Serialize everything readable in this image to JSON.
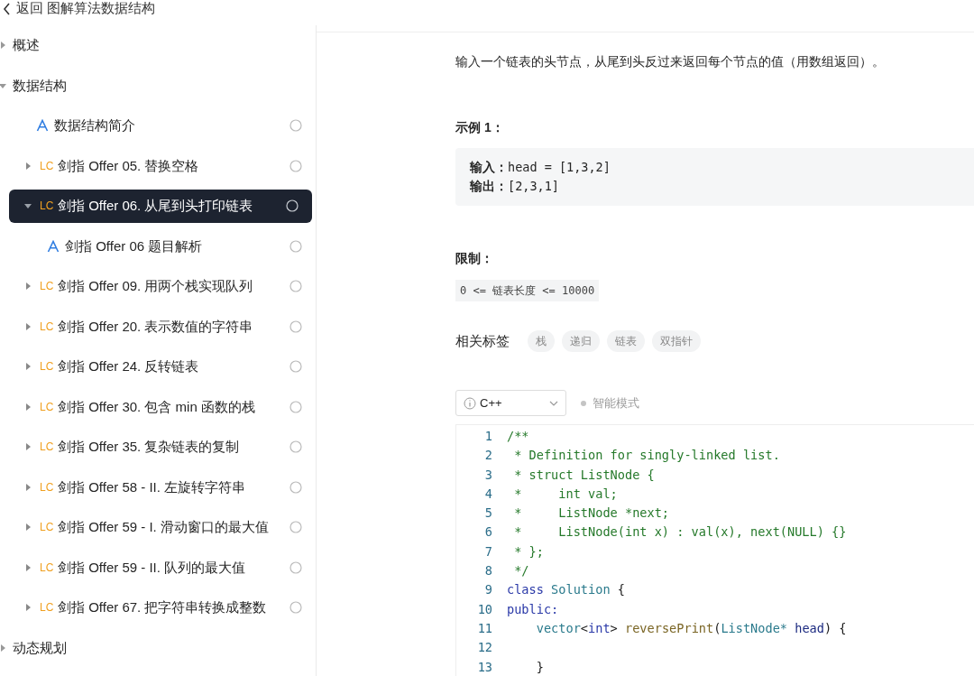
{
  "header": {
    "back_label": "返回 图解算法数据结构"
  },
  "sidebar": {
    "items": [
      {
        "label": "概述",
        "expanded": false
      },
      {
        "label": "数据结构",
        "expanded": true,
        "children": [
          {
            "kind": "article",
            "label": "数据结构简介",
            "selected": false,
            "done": false
          },
          {
            "kind": "leetcode",
            "badge": "LC",
            "label": "剑指 Offer 05. 替换空格",
            "expanded": false,
            "selected": false,
            "done": false
          },
          {
            "kind": "leetcode",
            "badge": "LC",
            "label": "剑指 Offer 06. 从尾到头打印链表",
            "expanded": true,
            "selected": true,
            "done": false,
            "children": [
              {
                "kind": "article",
                "label": "剑指 Offer 06 题目解析",
                "selected": false,
                "done": false
              }
            ]
          },
          {
            "kind": "leetcode",
            "badge": "LC",
            "label": "剑指 Offer 09. 用两个栈实现队列",
            "expanded": false,
            "selected": false,
            "done": false
          },
          {
            "kind": "leetcode",
            "badge": "LC",
            "label": "剑指 Offer 20. 表示数值的字符串",
            "expanded": false,
            "selected": false,
            "done": false
          },
          {
            "kind": "leetcode",
            "badge": "LC",
            "label": "剑指 Offer 24. 反转链表",
            "expanded": false,
            "selected": false,
            "done": false
          },
          {
            "kind": "leetcode",
            "badge": "LC",
            "label": "剑指 Offer 30. 包含 min 函数的栈",
            "expanded": false,
            "selected": false,
            "done": false
          },
          {
            "kind": "leetcode",
            "badge": "LC",
            "label": "剑指 Offer 35. 复杂链表的复制",
            "expanded": false,
            "selected": false,
            "done": false
          },
          {
            "kind": "leetcode",
            "badge": "LC",
            "label": "剑指 Offer 58 - II. 左旋转字符串",
            "expanded": false,
            "selected": false,
            "done": false
          },
          {
            "kind": "leetcode",
            "badge": "LC",
            "label": "剑指 Offer 59 - I. 滑动窗口的最大值",
            "expanded": false,
            "selected": false,
            "done": false
          },
          {
            "kind": "leetcode",
            "badge": "LC",
            "label": "剑指 Offer 59 - II. 队列的最大值",
            "expanded": false,
            "selected": false,
            "done": false
          },
          {
            "kind": "leetcode",
            "badge": "LC",
            "label": "剑指 Offer 67. 把字符串转换成整数",
            "expanded": false,
            "selected": false,
            "done": false
          }
        ]
      },
      {
        "label": "动态规划",
        "expanded": false
      }
    ]
  },
  "problem": {
    "description": "输入一个链表的头节点，从尾到头反过来返回每个节点的值（用数组返回）。",
    "example_title": "示例 1：",
    "example_lines": [
      {
        "label": "输入：",
        "value": "head = [1,3,2]"
      },
      {
        "label": "输出：",
        "value": "[2,3,1]"
      }
    ],
    "limit_title": "限制：",
    "limit": "0 <= 链表长度 <= 10000",
    "tags_label": "相关标签",
    "tags": [
      "栈",
      "递归",
      "链表",
      "双指针"
    ]
  },
  "editor": {
    "language": "C++",
    "mode_label": "智能模式",
    "mode_on": false,
    "lines": [
      {
        "number": "1",
        "tokens": [
          {
            "kind": "comment",
            "text": "/**"
          }
        ]
      },
      {
        "number": "2",
        "tokens": [
          {
            "kind": "comment",
            "text": " * Definition for singly-linked list."
          }
        ]
      },
      {
        "number": "3",
        "tokens": [
          {
            "kind": "comment",
            "text": " * struct ListNode {"
          }
        ]
      },
      {
        "number": "4",
        "tokens": [
          {
            "kind": "comment",
            "text": " *     int val;"
          }
        ]
      },
      {
        "number": "5",
        "tokens": [
          {
            "kind": "comment",
            "text": " *     ListNode *next;"
          }
        ]
      },
      {
        "number": "6",
        "tokens": [
          {
            "kind": "comment",
            "text": " *     ListNode(int x) : val(x), next(NULL) {}"
          }
        ]
      },
      {
        "number": "7",
        "tokens": [
          {
            "kind": "comment",
            "text": " * };"
          }
        ]
      },
      {
        "number": "8",
        "tokens": [
          {
            "kind": "comment",
            "text": " */"
          }
        ]
      },
      {
        "number": "9",
        "tokens": [
          {
            "kind": "keyword",
            "text": "class"
          },
          {
            "kind": "type",
            "text": " Solution"
          },
          {
            "kind": "plain",
            "text": " {"
          }
        ]
      },
      {
        "number": "10",
        "tokens": [
          {
            "kind": "keyword",
            "text": "public:"
          }
        ]
      },
      {
        "number": "11",
        "tokens": [
          {
            "kind": "type",
            "text": "    vector"
          },
          {
            "kind": "plain",
            "text": "<"
          },
          {
            "kind": "keyword",
            "text": "int"
          },
          {
            "kind": "plain",
            "text": "> "
          },
          {
            "kind": "func",
            "text": "reversePrint"
          },
          {
            "kind": "plain",
            "text": "("
          },
          {
            "kind": "type",
            "text": "ListNode*"
          },
          {
            "kind": "param",
            "text": " head"
          },
          {
            "kind": "plain",
            "text": ") {"
          }
        ]
      },
      {
        "number": "12"
      },
      {
        "number": "13",
        "tokens": [
          {
            "kind": "plain",
            "text": "    }"
          }
        ]
      }
    ]
  }
}
